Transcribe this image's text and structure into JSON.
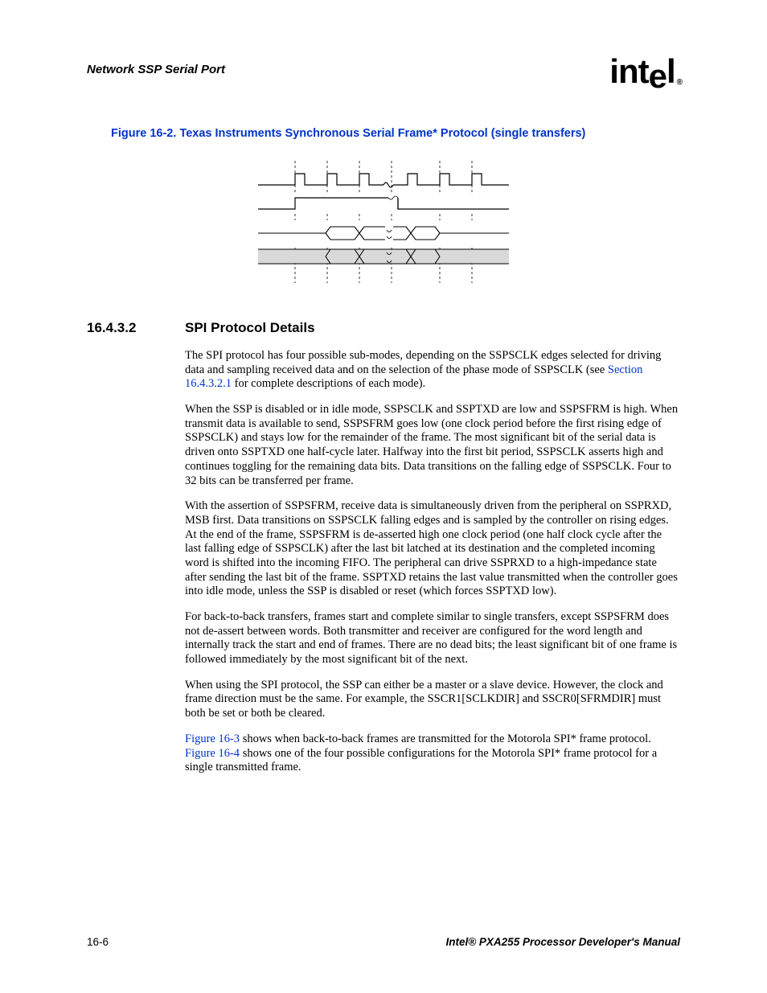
{
  "header": {
    "section": "Network SSP Serial Port",
    "logo_text": "intel",
    "logo_reg": "®"
  },
  "figure": {
    "caption": "Figure 16-2. Texas Instruments Synchronous Serial Frame* Protocol (single transfers)"
  },
  "heading": {
    "number": "16.4.3.2",
    "title": "SPI Protocol Details"
  },
  "paragraphs": {
    "p1a": "The SPI protocol has four possible sub-modes, depending on the SSPSCLK edges selected for driving data and sampling received data and on the selection of the phase mode of SSPSCLK (see ",
    "p1_link": "Section 16.4.3.2.1",
    "p1b": " for complete descriptions of each mode).",
    "p2": "When the SSP is disabled or in idle mode, SSPSCLK and SSPTXD are low and SSPSFRM is high. When transmit data is available to send, SSPSFRM goes low (one clock period before the first rising edge of SSPSCLK) and stays low for the remainder of the frame. The most significant bit of the serial data is driven onto SSPTXD one half-cycle later. Halfway into the first bit period, SSPSCLK asserts high and continues toggling for the remaining data bits. Data transitions on the falling edge of SSPSCLK. Four to 32 bits can be transferred per frame.",
    "p3": "With the assertion of SSPSFRM, receive data is simultaneously driven from the peripheral on SSPRXD, MSB first. Data transitions on SSPSCLK falling edges and is sampled by the controller on rising edges. At the end of the frame, SSPSFRM is de-asserted high one clock period (one half clock cycle after the last falling edge of SSPSCLK) after the last bit latched at its destination and the completed incoming word is shifted into the incoming FIFO. The peripheral can drive SSPRXD to a high-impedance state after sending the last bit of the frame. SSPTXD retains the last value transmitted when the controller goes into idle mode, unless the SSP is disabled or reset (which forces SSPTXD low).",
    "p4": "For back-to-back transfers, frames start and complete similar to single transfers, except SSPSFRM does not de-assert between words. Both transmitter and receiver are configured for the word length and internally track the start and end of frames. There are no dead bits; the least significant bit of one frame is followed immediately by the most significant bit of the next.",
    "p5": "When using the SPI protocol, the SSP can either be a master or a slave device. However, the clock and frame direction must be the same. For example, the SSCR1[SCLKDIR] and SSCR0[SFRMDIR] must both be set or both be cleared.",
    "p6_link1": "Figure 16-3",
    "p6a": " shows when back-to-back frames are transmitted for the Motorola SPI* frame protocol. ",
    "p6_link2": "Figure 16-4",
    "p6b": " shows one of the four possible configurations for the Motorola SPI* frame protocol for a single transmitted frame."
  },
  "footer": {
    "page": "16-6",
    "manual": "Intel® PXA255 Processor Developer's Manual"
  }
}
